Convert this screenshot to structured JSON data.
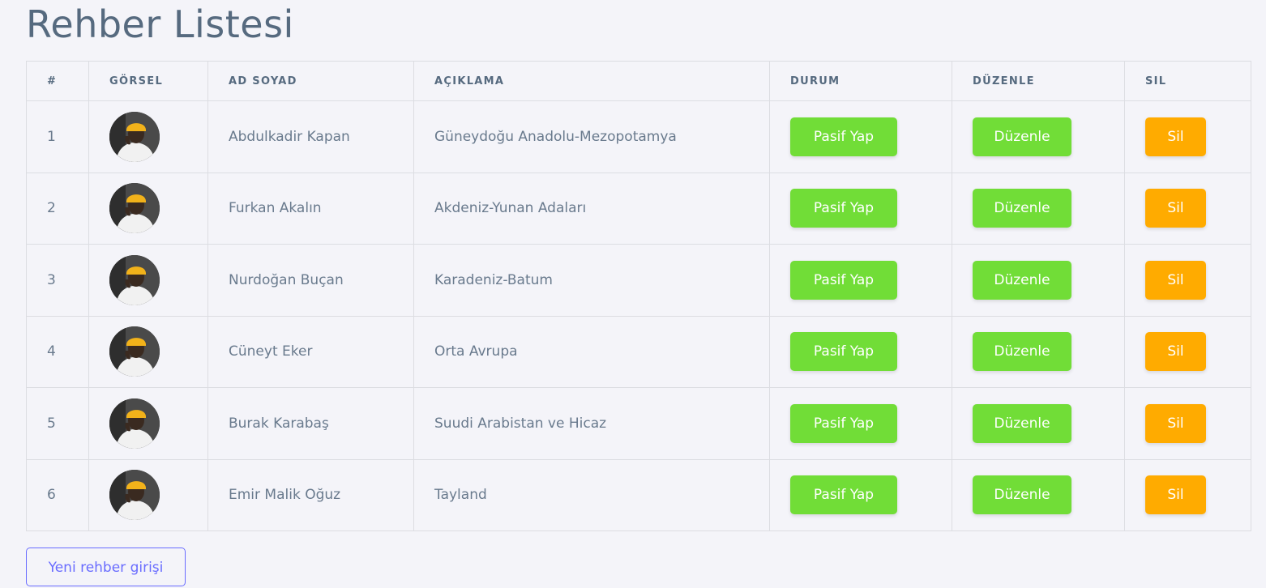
{
  "page": {
    "title": "Rehber Listesi"
  },
  "table": {
    "headers": {
      "index": "#",
      "image": "GÖRSEL",
      "name": "AD SOYAD",
      "description": "AÇIKLAMA",
      "status": "DURUM",
      "edit": "DÜZENLE",
      "delete": "SIL"
    },
    "rows": [
      {
        "index": "1",
        "name": "Abdulkadir Kapan",
        "description": "Güneydoğu Anadolu-Mezopotamya",
        "status_label": "Pasif Yap",
        "edit_label": "Düzenle",
        "delete_label": "Sil"
      },
      {
        "index": "2",
        "name": "Furkan Akalın",
        "description": "Akdeniz-Yunan Adaları",
        "status_label": "Pasif Yap",
        "edit_label": "Düzenle",
        "delete_label": "Sil"
      },
      {
        "index": "3",
        "name": "Nurdoğan Buçan",
        "description": "Karadeniz-Batum",
        "status_label": "Pasif Yap",
        "edit_label": "Düzenle",
        "delete_label": "Sil"
      },
      {
        "index": "4",
        "name": "Cüneyt Eker",
        "description": "Orta Avrupa",
        "status_label": "Pasif Yap",
        "edit_label": "Düzenle",
        "delete_label": "Sil"
      },
      {
        "index": "5",
        "name": "Burak Karabaş",
        "description": "Suudi Arabistan ve Hicaz",
        "status_label": "Pasif Yap",
        "edit_label": "Düzenle",
        "delete_label": "Sil"
      },
      {
        "index": "6",
        "name": "Emir Malik Oğuz",
        "description": "Tayland",
        "status_label": "Pasif Yap",
        "edit_label": "Düzenle",
        "delete_label": "Sil"
      }
    ]
  },
  "actions": {
    "new_entry_label": "Yeni rehber girişi"
  },
  "colors": {
    "background": "#f4f4f9",
    "status_button": "#71dd37",
    "edit_button": "#71dd37",
    "delete_button": "#ffab00",
    "primary_outline": "#696cff",
    "text": "#697a8d"
  }
}
